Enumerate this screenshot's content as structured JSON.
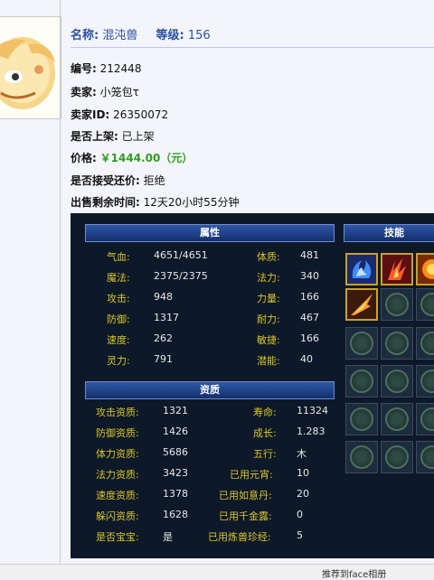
{
  "header": {
    "name_label": "名称:",
    "name_value": "混沌兽",
    "level_label": "等级:",
    "level_value": "156"
  },
  "info": [
    {
      "label": "编号:",
      "value": "212448"
    },
    {
      "label": "卖家:",
      "value": "小笼包τ"
    },
    {
      "label": "卖家ID:",
      "value": "26350072"
    },
    {
      "label": "是否上架:",
      "value": "已上架"
    },
    {
      "label": "价格:",
      "value": "￥1444.00（元）"
    },
    {
      "label": "是否接受还价:",
      "value": "拒绝"
    },
    {
      "label": "出售剩余时间:",
      "value": "12天20小时55分钟"
    }
  ],
  "attributes": {
    "title": "属性",
    "rows": [
      [
        {
          "k": "气血:",
          "v": "4651/4651"
        },
        {
          "k": "体质:",
          "v": "481"
        }
      ],
      [
        {
          "k": "魔法:",
          "v": "2375/2375"
        },
        {
          "k": "法力:",
          "v": "340"
        }
      ],
      [
        {
          "k": "攻击:",
          "v": "948"
        },
        {
          "k": "力量:",
          "v": "166"
        }
      ],
      [
        {
          "k": "防御:",
          "v": "1317"
        },
        {
          "k": "耐力:",
          "v": "467"
        }
      ],
      [
        {
          "k": "速度:",
          "v": "262"
        },
        {
          "k": "敏捷:",
          "v": "166"
        }
      ],
      [
        {
          "k": "灵力:",
          "v": "791"
        },
        {
          "k": "潜能:",
          "v": "40"
        }
      ]
    ]
  },
  "aptitude": {
    "title": "资质",
    "rows": [
      [
        {
          "k": "攻击资质:",
          "v": "1321"
        },
        {
          "k": "寿命:",
          "v": "11324"
        }
      ],
      [
        {
          "k": "防御资质:",
          "v": "1426"
        },
        {
          "k": "成长:",
          "v": "1.283"
        }
      ],
      [
        {
          "k": "体力资质:",
          "v": "5686"
        },
        {
          "k": "五行:",
          "v": "木"
        }
      ],
      [
        {
          "k": "法力资质:",
          "v": "3423"
        },
        {
          "k": "已用元宵:",
          "v": "10"
        }
      ],
      [
        {
          "k": "速度资质:",
          "v": "1378"
        },
        {
          "k": "已用如意丹:",
          "v": "20"
        }
      ],
      [
        {
          "k": "躲闪资质:",
          "v": "1628"
        },
        {
          "k": "已用千金露:",
          "v": "0"
        }
      ],
      [
        {
          "k": "是否宝宝:",
          "v": "是"
        },
        {
          "k": "已用炼兽珍经:",
          "v": "5"
        }
      ]
    ]
  },
  "skills": {
    "title": "技能",
    "filled": [
      "water-swirl-icon",
      "fire-claw-icon",
      "fire-orb-icon",
      "flame-strike-icon"
    ]
  },
  "footer": {
    "text": "推荐到face相册"
  }
}
